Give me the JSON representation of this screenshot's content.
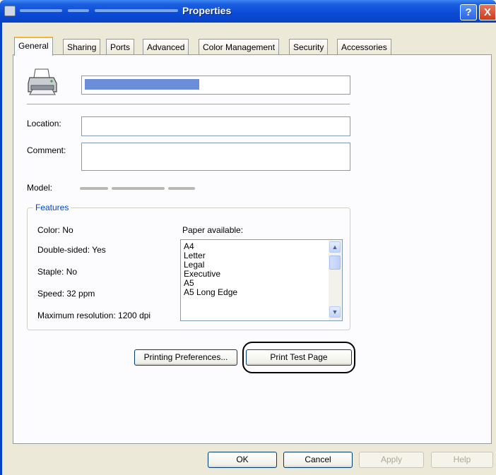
{
  "window": {
    "title": "Properties"
  },
  "tabs": [
    "General",
    "Sharing",
    "Ports",
    "Advanced",
    "Color Management",
    "Security",
    "Accessories"
  ],
  "general": {
    "location_label": "Location:",
    "comment_label": "Comment:",
    "model_label": "Model:",
    "features_legend": "Features",
    "color": "Color: No",
    "double_sided": "Double-sided: Yes",
    "staple": "Staple: No",
    "speed": "Speed: 32 ppm",
    "max_resolution": "Maximum resolution: 1200 dpi",
    "paper_available_label": "Paper available:",
    "paper_list": [
      "A4",
      "Letter",
      "Legal",
      "Executive",
      "A5",
      "A5 Long Edge"
    ]
  },
  "buttons": {
    "printing_preferences": "Printing Preferences...",
    "print_test_page": "Print Test Page",
    "ok": "OK",
    "cancel": "Cancel",
    "apply": "Apply",
    "help": "Help"
  },
  "titlebar_buttons": {
    "help": "?",
    "close": "X"
  },
  "icons": [
    "printer-icon",
    "help-icon",
    "close-icon",
    "scroll-up-icon",
    "scroll-down-icon"
  ],
  "colors": {
    "title_bar": "#0a4bd6",
    "tab_highlight": "#f8b33a",
    "features_legend": "#0046d5"
  }
}
